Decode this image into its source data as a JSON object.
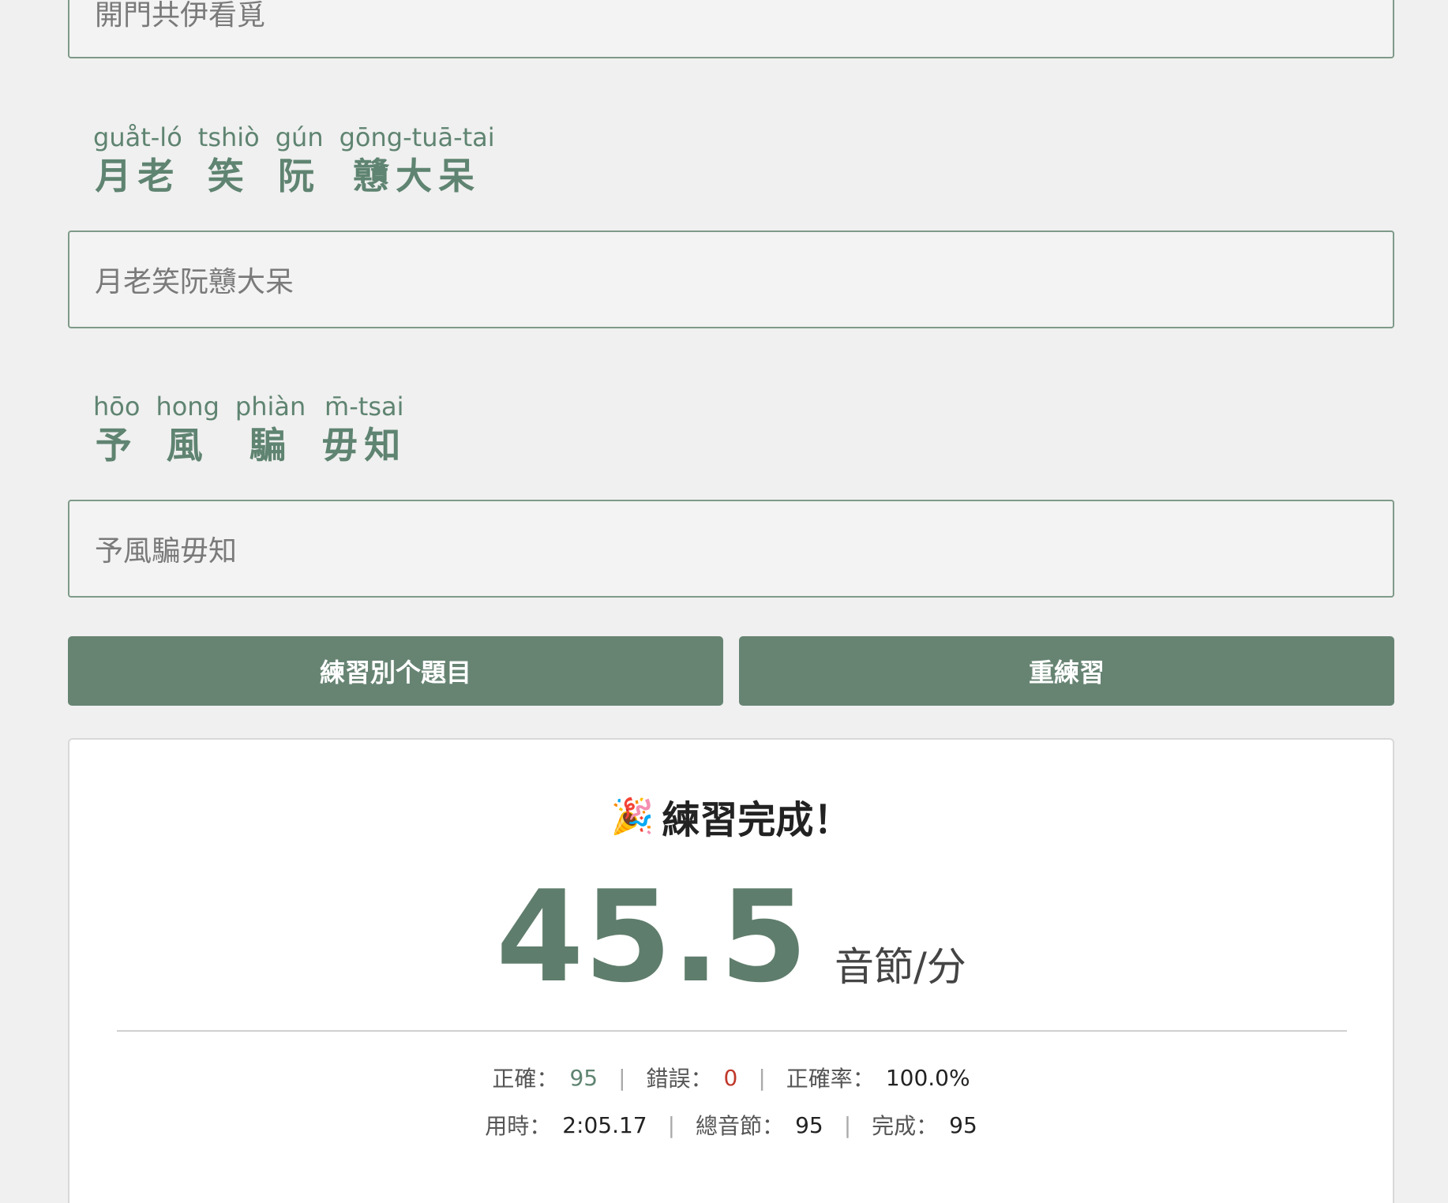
{
  "inputs": [
    {
      "value": "開門共伊看覓"
    },
    {
      "value": "月老笑阮戇大呆"
    },
    {
      "value": "予風騙毋知"
    }
  ],
  "prompts": [
    {
      "words": [
        {
          "roman": "guåt-ló",
          "hanzi": "月老"
        },
        {
          "roman": "tshiò",
          "hanzi": "笑"
        },
        {
          "roman": "gún",
          "hanzi": "阮"
        },
        {
          "roman": "gōng-tuā-tai",
          "hanzi": "戇大呆"
        }
      ]
    },
    {
      "words": [
        {
          "roman": "hōo",
          "hanzi": "予"
        },
        {
          "roman": "hong",
          "hanzi": "風"
        },
        {
          "roman": "phiàn",
          "hanzi": "騙"
        },
        {
          "roman": "m̄-tsai",
          "hanzi": "毋知"
        }
      ]
    }
  ],
  "buttons": {
    "other_topic": "練習別个題目",
    "retry": "重練習"
  },
  "result": {
    "title_icon": "party-popper-icon",
    "title_emoji": "🎉",
    "title": "練習完成！",
    "speed_value": "45.5",
    "speed_unit": "音節/分",
    "stats_row1": [
      {
        "label": "正確：",
        "value": "95",
        "color": "#5f8471"
      },
      {
        "label": "錯誤：",
        "value": "0",
        "color": "#c0392b"
      },
      {
        "label": "正確率：",
        "value": "100.0%"
      }
    ],
    "stats_row2": [
      {
        "label": "用時：",
        "value": "2:05.17"
      },
      {
        "label": "總音節：",
        "value": "95"
      },
      {
        "label": "完成：",
        "value": "95"
      }
    ]
  }
}
